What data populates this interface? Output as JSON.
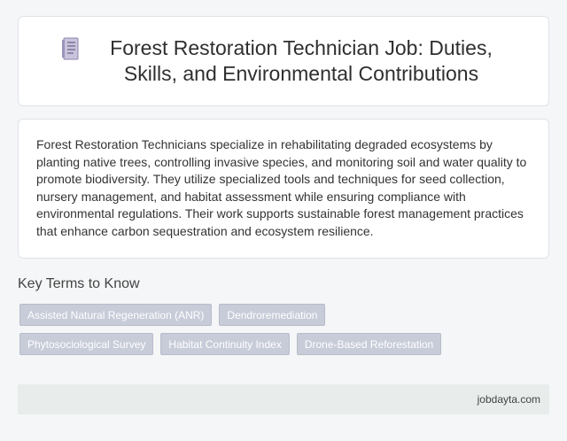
{
  "header": {
    "icon": "document-icon",
    "title": "Forest Restoration Technician Job: Duties, Skills, and Environmental Contributions"
  },
  "description": "Forest Restoration Technicians specialize in rehabilitating degraded ecosystems by planting native trees, controlling invasive species, and monitoring soil and water quality to promote biodiversity. They utilize specialized tools and techniques for seed collection, nursery management, and habitat assessment while ensuring compliance with environmental regulations. Their work supports sustainable forest management practices that enhance carbon sequestration and ecosystem resilience.",
  "key_terms": {
    "heading": "Key Terms to Know",
    "items": [
      "Assisted Natural Regeneration (ANR)",
      "Dendroremediation",
      "Phytosociological Survey",
      "Habitat Continuity Index",
      "Drone-Based Reforestation"
    ]
  },
  "footer": {
    "site": "jobdayta.com"
  },
  "colors": {
    "tag_bg": "#c8ccd9",
    "page_bg": "#f5f6f7",
    "footer_bg": "#e8eceb"
  }
}
